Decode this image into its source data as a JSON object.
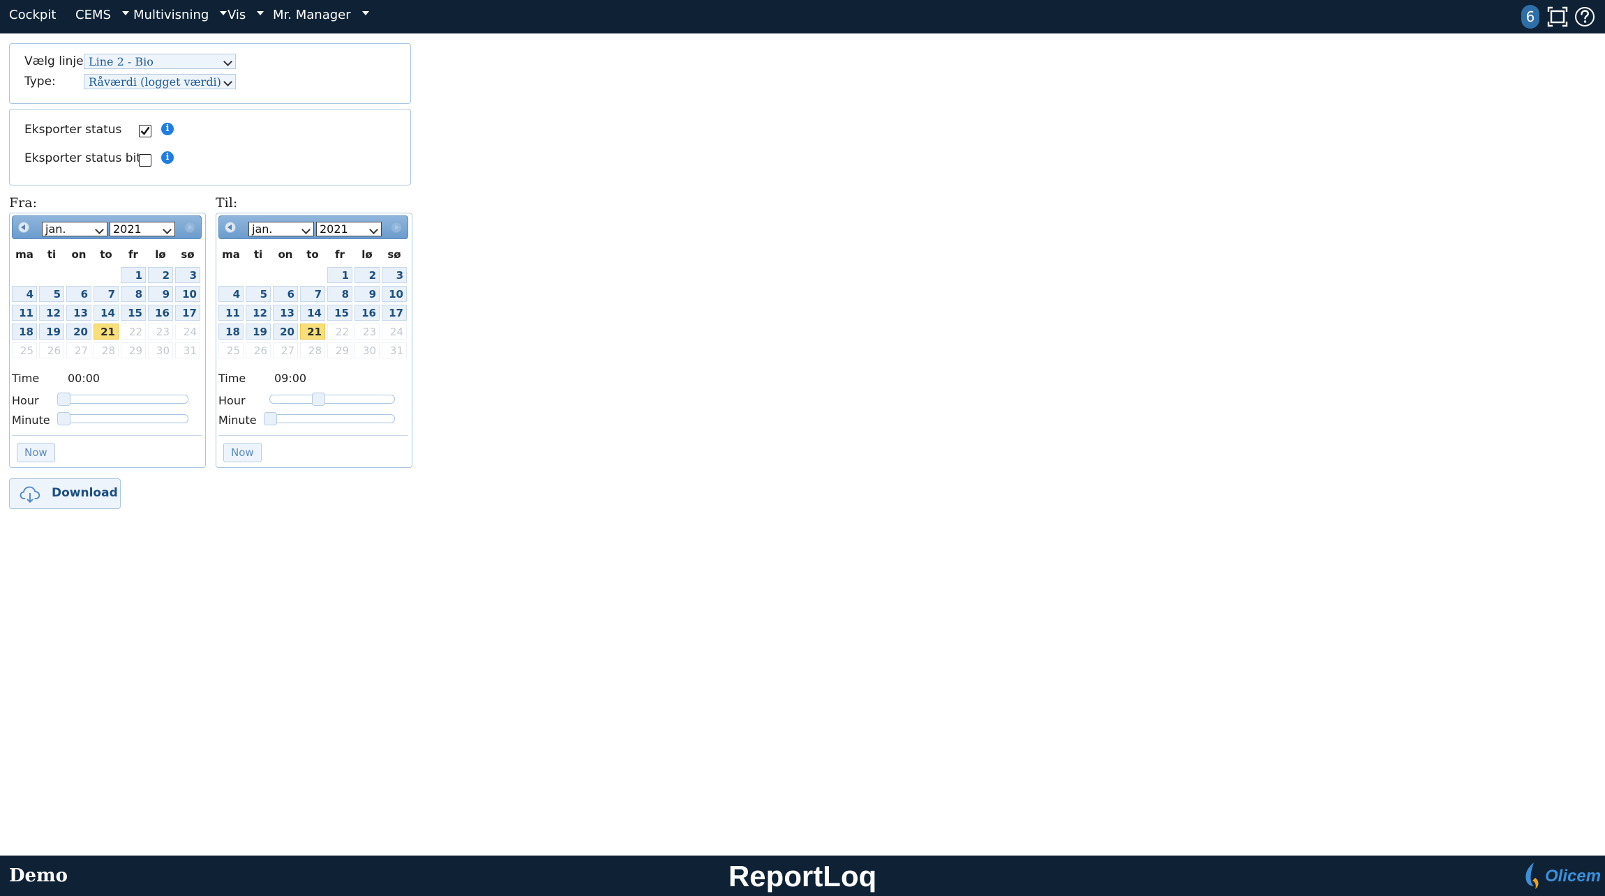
{
  "nav": {
    "items": [
      {
        "label": "Cockpit"
      },
      {
        "label": "CEMS"
      },
      {
        "label": "Multivisning"
      },
      {
        "label": "Vis"
      },
      {
        "label": "Mr. Manager"
      }
    ],
    "badge_count": "6",
    "icons": [
      "fullscreen-icon",
      "help-icon"
    ]
  },
  "filters": {
    "line_label": "Vælg linje:",
    "line_value": "Line 2 - Bio",
    "type_label": "Type:",
    "type_value": "Råværdi (logget værdi)"
  },
  "export": {
    "status_label": "Eksporter status",
    "status_checked": true,
    "status_bit_label": "Eksporter status bit",
    "status_bit_checked": false
  },
  "calendar_common": {
    "weekdays": [
      "ma",
      "ti",
      "on",
      "to",
      "fr",
      "lø",
      "sø"
    ],
    "time_label": "Time",
    "hour_label": "Hour",
    "minute_label": "Minute",
    "now_label": "Now"
  },
  "from": {
    "label": "Fra:",
    "month": "jan.",
    "year": "2021",
    "today": 21,
    "time": "00:00",
    "hour_fraction": 0.0,
    "minute_fraction": 0.0
  },
  "to": {
    "label": "Til:",
    "month": "jan.",
    "year": "2021",
    "today": 21,
    "time": "09:00",
    "hour_fraction": 0.39,
    "minute_fraction": 0.0
  },
  "download": {
    "label": "Download"
  },
  "footer": {
    "left": "Demo",
    "center": "ReportLoq",
    "logo_text": "Olicem"
  },
  "colors": {
    "navbar": "#0f2235",
    "accent": "#1d4f80",
    "today": "#f8df7a",
    "info": "#1e7de0"
  }
}
